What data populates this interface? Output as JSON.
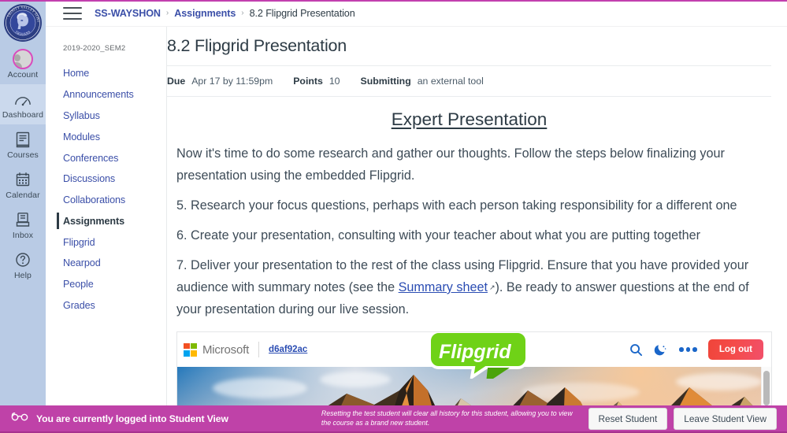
{
  "global_nav": {
    "logo": {
      "name": "trinity-valley-school-seal",
      "outer_text_top": "TRINITY VALLEY SCHOOL",
      "outer_text_bottom": "TROJANS"
    },
    "items": [
      {
        "label": "Account",
        "icon": "avatar-icon",
        "active": false
      },
      {
        "label": "Dashboard",
        "icon": "speedometer-icon",
        "active": true
      },
      {
        "label": "Courses",
        "icon": "book-icon",
        "active": false
      },
      {
        "label": "Calendar",
        "icon": "calendar-icon",
        "active": false
      },
      {
        "label": "Inbox",
        "icon": "inbox-icon",
        "active": false
      },
      {
        "label": "Help",
        "icon": "question-circle-icon",
        "active": false
      }
    ]
  },
  "topbar": {
    "menu_icon": "hamburger-icon",
    "breadcrumbs": [
      {
        "label": "SS-WAYSHON",
        "current": false
      },
      {
        "label": "Assignments",
        "current": false
      },
      {
        "label": "8.2 Flipgrid Presentation",
        "current": true
      }
    ],
    "separator": "›"
  },
  "course_nav": {
    "course_code": "2019-2020_SEM2",
    "items": [
      {
        "label": "Home",
        "active": false
      },
      {
        "label": "Announcements",
        "active": false
      },
      {
        "label": "Syllabus",
        "active": false
      },
      {
        "label": "Modules",
        "active": false
      },
      {
        "label": "Conferences",
        "active": false
      },
      {
        "label": "Discussions",
        "active": false
      },
      {
        "label": "Collaborations",
        "active": false
      },
      {
        "label": "Assignments",
        "active": true
      },
      {
        "label": "Flipgrid",
        "active": false
      },
      {
        "label": "Nearpod",
        "active": false
      },
      {
        "label": "People",
        "active": false
      },
      {
        "label": "Grades",
        "active": false
      }
    ]
  },
  "assignment": {
    "title": "8.2 Flipgrid Presentation",
    "meta": {
      "due_label": "Due",
      "due_value": "Apr 17 by 11:59pm",
      "points_label": "Points",
      "points_value": "10",
      "submitting_label": "Submitting",
      "submitting_value": "an external tool"
    },
    "body": {
      "heading": "Expert Presentation",
      "paragraphs": [
        "Now it's time to do some research and gather our thoughts.  Follow the steps below finalizing your presentation using the embedded Flipgrid.",
        "5. Research your focus questions, perhaps with each person taking responsibility for a different one",
        "6. Create your presentation, consulting with your teacher about what you are putting together"
      ],
      "final_paragraph": {
        "before_link": "7. Deliver your presentation to the rest of the class using Flipgrid. Ensure that you have provided your audience with summary notes (see the ",
        "link_text": "Summary sheet",
        "link_icon": "external-link-icon",
        "after_link": "). Be ready to answer questions at the end of your presentation during our live session."
      }
    }
  },
  "flipgrid_embed": {
    "microsoft_label": "Microsoft",
    "grid_code": "d6af92ac",
    "brand_label": "Flipgrid",
    "brand_color": "#6fd217",
    "toolbar_icons": [
      {
        "name": "search-icon",
        "glyph": "search"
      },
      {
        "name": "moon-icon",
        "glyph": "moon"
      },
      {
        "name": "more-options-icon",
        "glyph": "ellipsis"
      }
    ],
    "logout_label": "Log out",
    "logout_color": "#f2503f",
    "hero_alt": "mountain-range-at-sunset-banner",
    "scrollbar": "vertical-scrollbar"
  },
  "student_view_bar": {
    "icon": "eyeglasses-icon",
    "message": "You are currently logged into Student View",
    "note": "Resetting the test student will clear all history for this student, allowing you to view the course as a brand new student.",
    "buttons": [
      {
        "label": "Reset Student"
      },
      {
        "label": "Leave Student View"
      }
    ],
    "background_color": "#bf42a8"
  }
}
